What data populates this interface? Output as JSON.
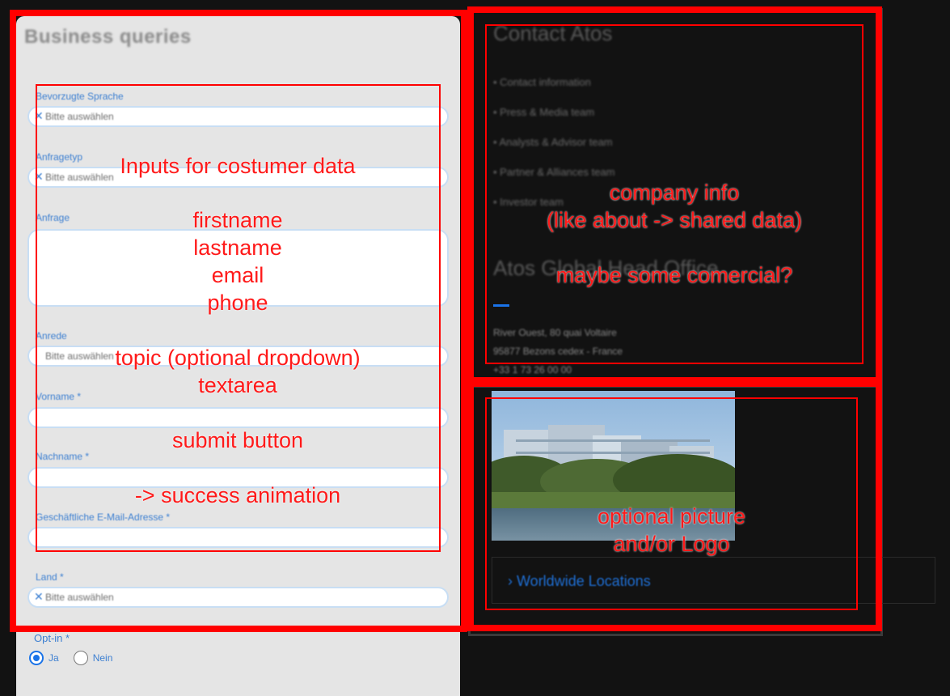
{
  "left_form": {
    "title": "Business queries",
    "fields": [
      {
        "label": "Bevorzugte Sprache",
        "placeholder": "Bitte auswählen"
      },
      {
        "label": "Anfragetyp",
        "placeholder": "Bitte auswählen"
      },
      {
        "label": "Anfrage"
      },
      {
        "label": "Anrede",
        "placeholder": "Bitte auswählen"
      },
      {
        "label": "Vorname *"
      },
      {
        "label": "Nachname *"
      },
      {
        "label": "Geschäftliche E-Mail-Adresse *"
      },
      {
        "label": "Land *",
        "placeholder": "Bitte auswählen"
      }
    ],
    "optin": {
      "label": "Opt-in *",
      "yes": "Ja",
      "no": "Nein"
    }
  },
  "contact": {
    "title": "Contact Atos",
    "items": [
      "Contact information",
      "Press & Media team",
      "Analysts & Advisor team",
      "Partner & Alliances team",
      "Investor team"
    ],
    "hq_title": "Atos Global Head Office",
    "address": [
      "River Ouest, 80 quai Voltaire",
      "95877 Bezons cedex - France",
      "+33 1 73 26 00 00"
    ]
  },
  "locations": {
    "link": "Worldwide Locations",
    "arrow": "›"
  },
  "annotations": {
    "left_heading": "Inputs for costumer data",
    "left_fields": [
      "firstname",
      "lastname",
      "email",
      "phone"
    ],
    "left_topic": "topic (optional dropdown)",
    "left_textarea": "textarea",
    "left_submit": "submit button",
    "left_success": "-> success animation",
    "right_top_1": "company info",
    "right_top_2": "(like about -> shared data)",
    "right_top_3": "maybe some comercial?",
    "right_bottom_1": "optional picture",
    "right_bottom_2": "and/or Logo"
  },
  "colors": {
    "annotation": "#ff0000",
    "accent": "#1a73e8",
    "panel": "#e5e5e5",
    "background": "#121212"
  }
}
